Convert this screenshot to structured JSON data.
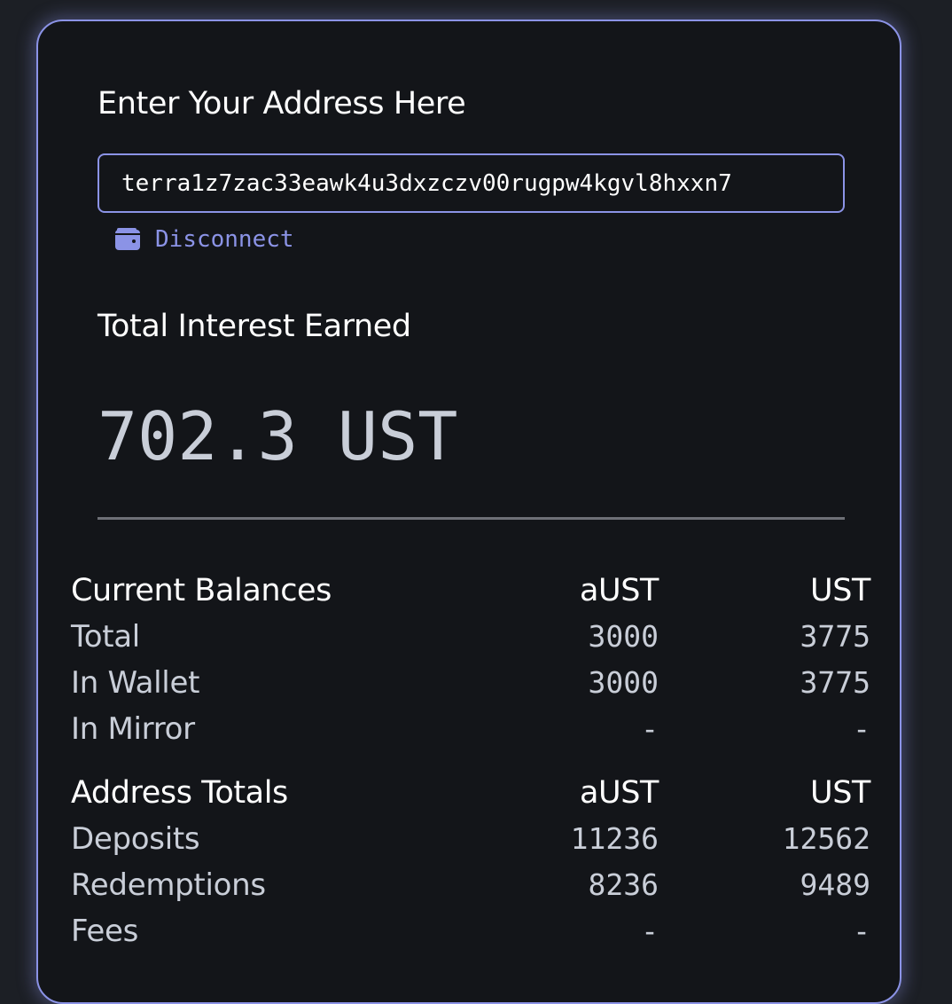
{
  "address": {
    "label": "Enter Your Address Here",
    "value": "terra1z7zac33eawk4u3dxzczv00rugpw4kgvl8hxxn7",
    "disconnect_label": "Disconnect",
    "disconnect_icon": "wallet-icon",
    "accent_color": "#8b93e6"
  },
  "interest": {
    "label": "Total Interest Earned",
    "value": "702.3 UST"
  },
  "current_balances": {
    "header": {
      "label": "Current Balances",
      "col_a": "aUST",
      "col_b": "UST"
    },
    "rows": [
      {
        "label": "Total",
        "a": "3000",
        "b": "3775"
      },
      {
        "label": "In Wallet",
        "a": "3000",
        "b": "3775"
      },
      {
        "label": "In Mirror",
        "a": "-",
        "b": "-"
      }
    ]
  },
  "address_totals": {
    "header": {
      "label": "Address Totals",
      "col_a": "aUST",
      "col_b": "UST"
    },
    "rows": [
      {
        "label": "Deposits",
        "a": "11236",
        "b": "12562"
      },
      {
        "label": "Redemptions",
        "a": "8236",
        "b": "9489"
      },
      {
        "label": "Fees",
        "a": "-",
        "b": "-"
      }
    ]
  }
}
